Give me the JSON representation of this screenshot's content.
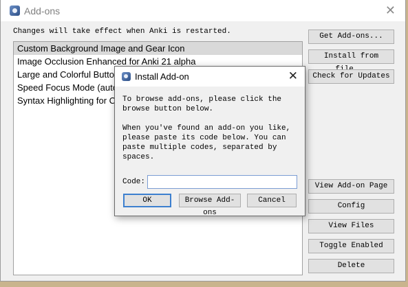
{
  "window": {
    "title": "Add-ons",
    "close_glyph": "✕",
    "notice": "Changes will take effect when Anki is restarted."
  },
  "addons": [
    {
      "name": "Custom Background Image and Gear Icon",
      "selected": true
    },
    {
      "name": "Image Occlusion Enhanced for Anki 21 alpha",
      "selected": false
    },
    {
      "name": "Large and Colorful Buttons",
      "selected": false
    },
    {
      "name": "Speed Focus Mode (auto-alert, auto-reveal, auto-answer)",
      "selected": false
    },
    {
      "name": "Syntax Highlighting for Code",
      "selected": false
    }
  ],
  "side_buttons": {
    "get_addons": "Get Add-ons...",
    "install_from_file": "Install from file...",
    "check_updates": "Check for Updates",
    "view_page": "View Add-on Page",
    "config": "Config",
    "view_files": "View Files",
    "toggle_enabled": "Toggle Enabled",
    "delete": "Delete"
  },
  "dialog": {
    "title": "Install Add-on",
    "close_glyph": "✕",
    "para1": "To browse add-ons, please click the browse button below.",
    "para2": "When you've found an add-on you like, please paste its code below. You can paste multiple codes, separated by spaces.",
    "code_label": "Code:",
    "code_value": "",
    "ok": "OK",
    "browse": "Browse Add-ons",
    "cancel": "Cancel"
  },
  "icons": {
    "app": "anki-star-icon",
    "close": "close-icon"
  }
}
